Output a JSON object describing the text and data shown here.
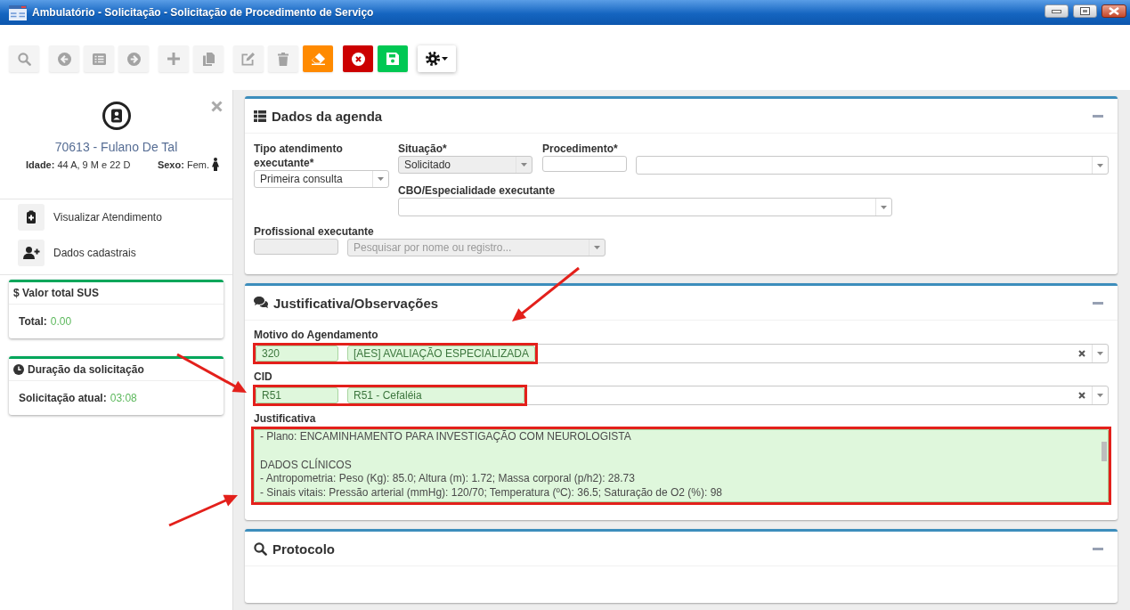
{
  "window": {
    "title": "Ambulatório - Solicitação - Solicitação de Procedimento de Serviço"
  },
  "toolbar": {
    "groups": [
      {
        "buttons": [
          {
            "disabled": true,
            "color": "#f4f4f4"
          }
        ]
      },
      {
        "buttons": [
          {
            "disabled": true,
            "color": "#f4f4f4"
          },
          {
            "disabled": true,
            "color": "#f4f4f4"
          },
          {
            "disabled": true,
            "color": "#f4f4f4"
          }
        ]
      },
      {
        "buttons": [
          {
            "disabled": true,
            "color": "#f4f4f4"
          },
          {
            "disabled": true,
            "color": "#f4f4f4"
          }
        ]
      },
      {
        "buttons": [
          {
            "disabled": true,
            "color": "#f4f4f4"
          },
          {
            "disabled": true,
            "color": "#f4f4f4"
          },
          {
            "disabled": false,
            "color": "#ff8a00"
          }
        ]
      },
      {
        "buttons": [
          {
            "disabled": false,
            "color": "#cc0000"
          },
          {
            "disabled": false,
            "color": "#00c853"
          }
        ]
      },
      {
        "buttons": [
          {
            "disabled": false,
            "color": "#ffffff"
          }
        ]
      }
    ]
  },
  "patient": {
    "name": "70613 - Fulano De Tal",
    "age": "**Idade:** 44 A, 9 M e 22 D",
    "sex": "**Sexo:** Fem."
  },
  "patient_menu": [
    {
      "label": "Visualizar Atendimento"
    },
    {
      "label": "Dados cadastrais"
    }
  ],
  "summary_cards": [
    {
      "kind": "total",
      "title": "$ Valor total SUS",
      "label": "Total:",
      "value": "0.00"
    },
    {
      "kind": "timer",
      "title": "Duração da solicitação",
      "label": "Solicitação atual:",
      "value": "03:08"
    }
  ],
  "agenda": {
    "title": "Dados da agenda",
    "attendance_type": {
      "label": "Tipo atendimento executante*",
      "value": "Primeira consulta"
    },
    "status": {
      "label": "Situação*",
      "value": "Solicitado",
      "disabled": true
    },
    "procedure": {
      "label": "Procedimento*"
    },
    "specialty": {
      "label": "CBO/Especialidade executante"
    },
    "professional": {
      "label": "Profissional executante",
      "placeholder": "Pesquisar por nome ou registro...",
      "disabled": true
    }
  },
  "justification": {
    "title": "Justificativa/Observações",
    "reason": {
      "label": "Motivo do Agendamento",
      "code": "320",
      "value": "[AES] AVALIAÇÃO ESPECIALIZADA",
      "valid": true,
      "highlighted": true
    },
    "cid": {
      "label": "CID",
      "code": "R51",
      "value": "R51 - Cefaléia",
      "valid": true,
      "highlighted": true
    },
    "text": {
      "label": "Justificativa",
      "value": "- Plano: ENCAMINHAMENTO PARA INVESTIGAÇÃO COM NEUROLOGISTA\n\nDADOS CLÍNICOS\n- Antropometria: Peso (Kg): 85.0; Altura (m): 1.72; Massa corporal (p/h2): 28.73\n- Sinais vitais: Pressão arterial (mmHg): 120/70; Temperatura (ºC): 36.5; Saturação de O2 (%): 98",
      "valid": true,
      "highlighted": true
    }
  },
  "protocol": {
    "title": "Protocolo"
  }
}
